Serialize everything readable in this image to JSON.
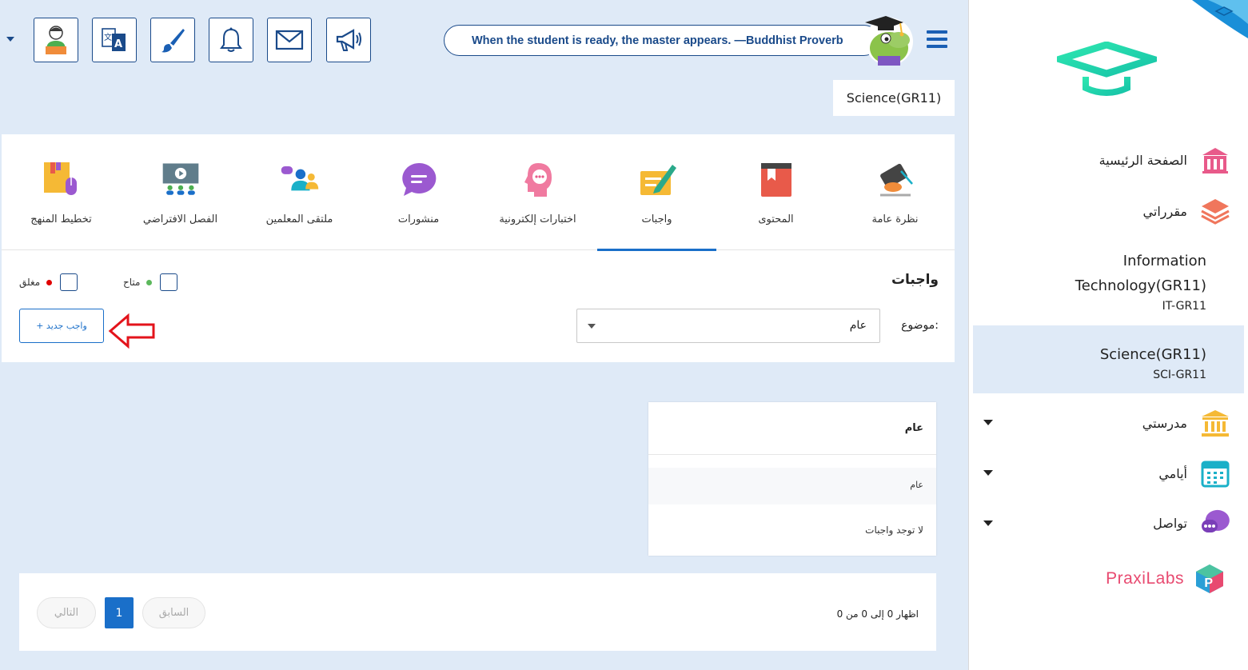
{
  "topbar": {
    "quote": "When the student is ready, the master appears. —Buddhist Proverb",
    "course_badge": "Science(GR11)",
    "buttons": [
      "profile-icon",
      "translate-icon",
      "brush-icon",
      "bell-icon",
      "mail-icon",
      "megaphone-icon"
    ]
  },
  "sidebar": {
    "home": "الصفحة الرئيسية",
    "my_courses": "مقرراتي",
    "courses": [
      {
        "name": "Information Technology(GR11)",
        "name_line1": "Information",
        "name_line2": "Technology(GR11)",
        "code": "IT-GR11"
      },
      {
        "name": "Science(GR11)",
        "code": "SCI-GR11"
      }
    ],
    "my_school": "مدرستي",
    "my_days": "أيامي",
    "communication": "تواصل",
    "praxilabs": "PraxiLabs"
  },
  "tabs": [
    {
      "label": "نظرة عامة",
      "icon": "overview-icon"
    },
    {
      "label": "المحتوى",
      "icon": "book-icon"
    },
    {
      "label": "واجبات",
      "icon": "homework-icon",
      "active": true
    },
    {
      "label": "اختبارات إلكترونية",
      "icon": "quiz-icon"
    },
    {
      "label": "منشورات",
      "icon": "chat-bubble-icon"
    },
    {
      "label": "ملتقى المعلمين",
      "icon": "teachers-icon"
    },
    {
      "label": "الفصل الافتراضي",
      "icon": "virtual-class-icon"
    },
    {
      "label": "تخطيط المنهج",
      "icon": "curriculum-icon"
    }
  ],
  "homework": {
    "title": "واجبات",
    "legend_available": "متاح",
    "legend_closed": "مغلق",
    "topic_label": "موضوع:",
    "topic_value": "عام",
    "new_button": "+ واجب جديد",
    "card_header": "عام",
    "card_row": "عام",
    "empty_text": "لا توجد واجبات"
  },
  "pagination": {
    "info": "اظهار 0 إلى 0 من 0",
    "prev": "السابق",
    "page": "1",
    "next": "التالي"
  },
  "colors": {
    "accent": "#1a6fc9",
    "available_dot": "#5cb85c",
    "closed_dot": "#e00000",
    "arrow_outline": "#e3131b"
  }
}
